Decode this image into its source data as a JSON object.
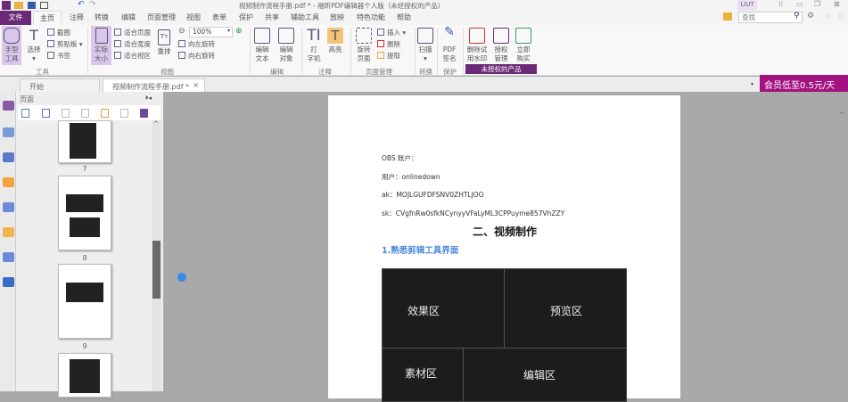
{
  "titlebar": {
    "title": "视频制作流程手册.pdf * - 福昕PDF编辑器个人版（未经授权的产品）",
    "user": "LIUT"
  },
  "menu": [
    "文件",
    "主页",
    "注释",
    "转换",
    "编辑",
    "页面管理",
    "视图",
    "表单",
    "保护",
    "共享",
    "辅助工具",
    "放映",
    "特色功能",
    "帮助"
  ],
  "search": {
    "placeholder": "查找"
  },
  "ribbon": {
    "hand": "手型\n工具",
    "select": "选择",
    "screenshot": "截图",
    "clipboard": "剪贴板",
    "bookmark": "书签",
    "group_tools": "工具",
    "actual_size": "实际\n大小",
    "fit_page": "适合页面",
    "fit_width": "适合宽度",
    "fit_view": "适合视区",
    "reflow": "重排",
    "zoom": "100%",
    "rotate_left": "向左旋转",
    "rotate_right": "向右旋转",
    "group_view": "视图",
    "edit_text": "编辑\n文本",
    "edit_object": "编辑\n对象",
    "group_edit": "编辑",
    "typewriter": "打\n字机",
    "highlight": "高亮",
    "group_comment": "注释",
    "rotate_page": "旋转\n页面",
    "insert": "插入",
    "delete": "删除",
    "extract": "提取",
    "group_pages": "页面管理",
    "scan": "扫描",
    "group_convert": "转换",
    "pdf_sign": "PDF\n签名",
    "group_protect": "保护",
    "remove_watermark": "删除试\n用水印",
    "license_manage": "授权\n管理",
    "buy_now": "立即\n购买",
    "group_unlicensed": "未授权的产品"
  },
  "tabs": {
    "start": "开始",
    "doc": "视频制作流程手册.pdf *"
  },
  "promo": "会员低至0.5元/天",
  "panel": {
    "title": "页面",
    "pages": [
      "7",
      "8",
      "9"
    ]
  },
  "document": {
    "lines": [
      "OBS 账户：",
      "用户：onlinedown",
      "ak：MOJLGUFDFSNV0ZHTLJOO",
      "sk：CVgfnRw0sfkNCynyyVFaLyML3CPPuyme857VhZZY"
    ],
    "heading": "二、视频制作",
    "subheading": "1.熟悉剪辑工具界面",
    "zones": [
      "效果区",
      "预览区",
      "素材区",
      "编辑区"
    ]
  },
  "colors": {
    "accent": "#a3137f",
    "tab_purple": "#6b2a77",
    "highlight": "#f5c27a"
  }
}
